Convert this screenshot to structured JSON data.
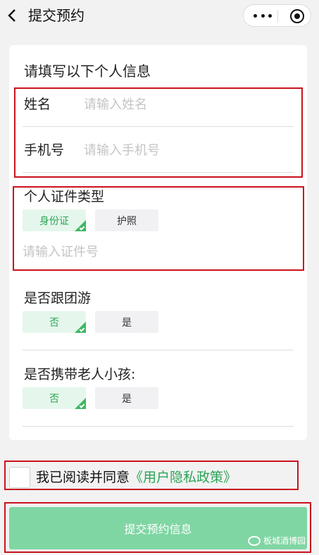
{
  "nav": {
    "title": "提交预约"
  },
  "card": {
    "title": "请填写以下个人信息"
  },
  "name_field": {
    "label": "姓名",
    "placeholder": "请输入姓名",
    "value": ""
  },
  "phone_field": {
    "label": "手机号",
    "placeholder": "请输入手机号",
    "value": ""
  },
  "id_type": {
    "label": "个人证件类型",
    "options": [
      "身份证",
      "护照"
    ],
    "selected": "身份证",
    "input_placeholder": "请输入证件号",
    "input_value": ""
  },
  "group_tour": {
    "label": "是否跟团游",
    "options": [
      "否",
      "是"
    ],
    "selected": "否"
  },
  "with_elderly_children": {
    "label": "是否携带老人小孩:",
    "options": [
      "否",
      "是"
    ],
    "selected": "否"
  },
  "agreement": {
    "text": "我已阅读并同意",
    "link": "《用户隐私政策》",
    "checked": false
  },
  "submit": {
    "label": "提交预约信息"
  },
  "watermark": {
    "text": "板城酒博园"
  },
  "colors": {
    "accent": "#2aa556",
    "submit_bg": "#7fd6a3",
    "highlight_box": "#c9131e"
  }
}
